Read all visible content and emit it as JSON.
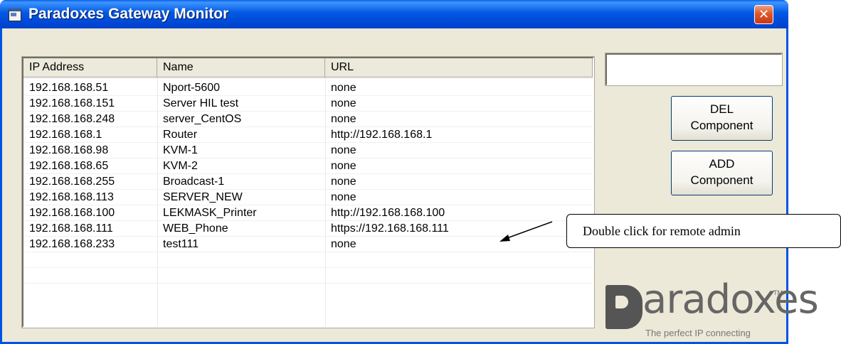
{
  "window": {
    "title": "Paradoxes Gateway Monitor",
    "close_glyph": "✕"
  },
  "list": {
    "columns": [
      "IP Address",
      "Name",
      "URL"
    ],
    "rows": [
      [
        "192.168.168.51",
        "Nport-5600",
        "none"
      ],
      [
        "192.168.168.151",
        "Server HIL test",
        "none"
      ],
      [
        "192.168.168.248",
        "server_CentOS",
        "none"
      ],
      [
        "192.168.168.1",
        "Router",
        "http://192.168.168.1"
      ],
      [
        "192.168.168.98",
        "KVM-1",
        "none"
      ],
      [
        "192.168.168.65",
        "KVM-2",
        "none"
      ],
      [
        "192.168.168.255",
        "Broadcast-1",
        "none"
      ],
      [
        "192.168.168.113",
        "SERVER_NEW",
        "none"
      ],
      [
        "192.168.168.100",
        "LEKMASK_Printer",
        "http://192.168.168.100"
      ],
      [
        "192.168.168.111",
        "WEB_Phone",
        "https://192.168.168.111"
      ],
      [
        "192.168.168.233",
        "test111",
        "none"
      ]
    ]
  },
  "textbox": {
    "value": ""
  },
  "buttons": {
    "del": {
      "line1": "DEL",
      "line2": "Component"
    },
    "add": {
      "line1": "ADD",
      "line2": "Component"
    }
  },
  "callout": {
    "text": "Double click  for remote admin"
  },
  "logo": {
    "text": "aradoxes",
    "tm": "TM",
    "tagline": "The perfect IP connecting"
  },
  "colors": {
    "titlebar": "#0054e3",
    "window_bg": "#ece9d8",
    "close": "#e2552b"
  },
  "icons": {
    "window": "app-window-icon",
    "close": "close-icon",
    "arrow": "pointer-arrow-icon"
  }
}
